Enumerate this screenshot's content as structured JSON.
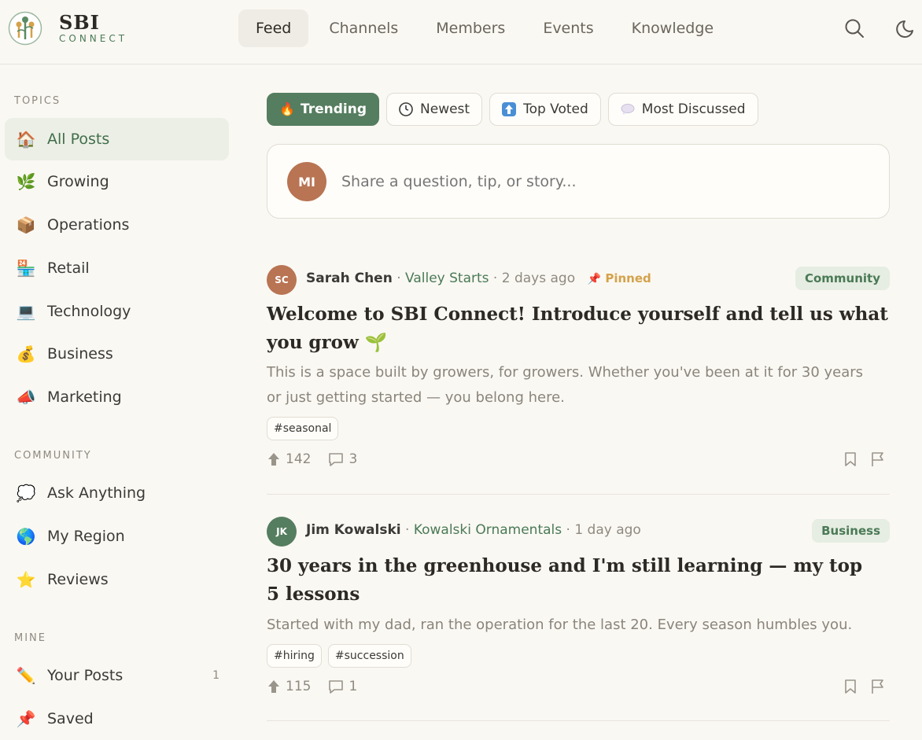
{
  "brand": {
    "name": "SBI",
    "tagline": "CONNECT"
  },
  "nav": {
    "items": [
      {
        "label": "Feed",
        "active": true
      },
      {
        "label": "Channels",
        "active": false
      },
      {
        "label": "Members",
        "active": false
      },
      {
        "label": "Events",
        "active": false
      },
      {
        "label": "Knowledge",
        "active": false
      }
    ]
  },
  "sidebar": {
    "topics_title": "TOPICS",
    "topics": [
      {
        "label": "All Posts",
        "icon": "house-icon",
        "emoji": "🏠",
        "active": true
      },
      {
        "label": "Growing",
        "icon": "herb-icon",
        "emoji": "🌿"
      },
      {
        "label": "Operations",
        "icon": "package-icon",
        "emoji": "📦"
      },
      {
        "label": "Retail",
        "icon": "store-icon",
        "emoji": "🏪"
      },
      {
        "label": "Technology",
        "icon": "computer-icon",
        "emoji": "💻"
      },
      {
        "label": "Business",
        "icon": "money-bag-icon",
        "emoji": "💰"
      },
      {
        "label": "Marketing",
        "icon": "megaphone-icon",
        "emoji": "📣"
      }
    ],
    "community_title": "COMMUNITY",
    "community": [
      {
        "label": "Ask Anything",
        "icon": "speech-bubble-icon",
        "emoji": "💭"
      },
      {
        "label": "My Region",
        "icon": "globe-icon",
        "emoji": "🌎"
      },
      {
        "label": "Reviews",
        "icon": "star-icon",
        "emoji": "⭐"
      }
    ],
    "mine_title": "MINE",
    "mine": [
      {
        "label": "Your Posts",
        "icon": "pencil-icon",
        "emoji": "✏️",
        "count": "1"
      },
      {
        "label": "Saved",
        "icon": "pushpin-icon",
        "emoji": "📌"
      }
    ]
  },
  "filters": [
    {
      "label": "Trending",
      "icon": "fire-icon",
      "active": true
    },
    {
      "label": "Newest",
      "icon": "clock-icon",
      "active": false
    },
    {
      "label": "Top Voted",
      "icon": "up-arrow-icon",
      "active": false
    },
    {
      "label": "Most Discussed",
      "icon": "speech-bubble-icon",
      "active": false
    }
  ],
  "composer": {
    "avatar_initials": "MI",
    "placeholder": "Share a question, tip, or story..."
  },
  "posts": [
    {
      "initials": "SC",
      "avatar_color": "#b87453",
      "author": "Sarah Chen",
      "farm": "Valley Starts",
      "time": "2 days ago",
      "pinned_label": "Pinned",
      "category": "Community",
      "title": "Welcome to SBI Connect! Introduce yourself and tell us what you grow 🌱",
      "body": "This is a space built by growers, for growers. Whether you've been at it for 30 years or just getting started — you belong here.",
      "hashtags": [
        "#seasonal"
      ],
      "upvotes": "142",
      "comments": "3"
    },
    {
      "initials": "JK",
      "avatar_color": "#557d5f",
      "author": "Jim Kowalski",
      "farm": "Kowalski Ornamentals",
      "time": "1 day ago",
      "category": "Business",
      "title": "30 years in the greenhouse and I'm still learning — my top 5 lessons",
      "body": "Started with my dad, ran the operation for the last 20. Every season humbles you.",
      "hashtags": [
        "#hiring",
        "#succession"
      ],
      "upvotes": "115",
      "comments": "1"
    }
  ],
  "colors": {
    "accent": "#557d5f",
    "brand_green": "#4a7a56",
    "pinned": "#d4a24a",
    "background": "#faf8f3"
  }
}
